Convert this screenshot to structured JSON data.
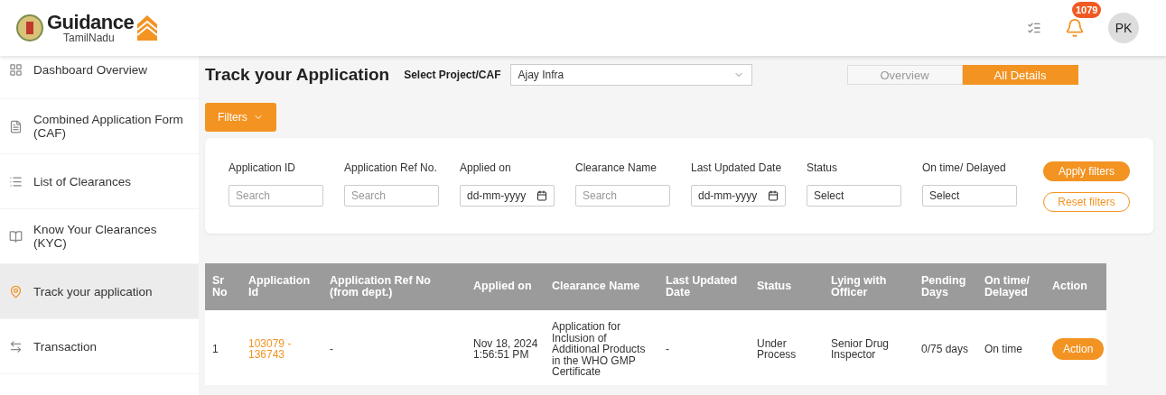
{
  "header": {
    "logo": {
      "title": "Guidance",
      "subtitle": "TamilNadu"
    },
    "notifications": {
      "count": "1079"
    },
    "user": {
      "initials": "PK"
    }
  },
  "sidebar": {
    "items": [
      {
        "label": "Dashboard Overview",
        "selected": false
      },
      {
        "label": "Combined Application Form (CAF)",
        "selected": false
      },
      {
        "label": "List of Clearances",
        "selected": false
      },
      {
        "label": "Know Your Clearances (KYC)",
        "selected": false
      },
      {
        "label": "Track your application",
        "selected": true
      },
      {
        "label": "Transaction",
        "selected": false
      }
    ]
  },
  "page": {
    "title": "Track your Application",
    "project_select": {
      "label": "Select Project/CAF",
      "value": "Ajay Infra"
    },
    "view_tabs": [
      {
        "label": "Overview",
        "selected": false
      },
      {
        "label": "All Details",
        "selected": true
      }
    ],
    "filters_button": "Filters"
  },
  "filters": {
    "fields": [
      {
        "label": "Application ID",
        "kind": "text",
        "placeholder": "Search"
      },
      {
        "label": "Application Ref No.",
        "kind": "text",
        "placeholder": "Search"
      },
      {
        "label": "Applied on",
        "kind": "date",
        "value": "dd-mm-yyyy"
      },
      {
        "label": "Clearance Name",
        "kind": "text",
        "placeholder": "Search"
      },
      {
        "label": "Last Updated Date",
        "kind": "date",
        "value": "dd-mm-yyyy"
      },
      {
        "label": "Status",
        "kind": "select",
        "value": "Select"
      },
      {
        "label": "On time/ Delayed",
        "kind": "select",
        "value": "Select"
      }
    ],
    "apply": "Apply filters",
    "reset": "Reset filters"
  },
  "table": {
    "columns": [
      {
        "label": "Sr No",
        "kind": "text"
      },
      {
        "label": "Application Id",
        "kind": "link"
      },
      {
        "label": "Application Ref No (from dept.)",
        "kind": "text"
      },
      {
        "label": "Applied on",
        "kind": "text"
      },
      {
        "label": "Clearance Name",
        "kind": "text"
      },
      {
        "label": "Last Updated Date",
        "kind": "text"
      },
      {
        "label": "Status",
        "kind": "text"
      },
      {
        "label": "Lying with Officer",
        "kind": "text"
      },
      {
        "label": "Pending Days",
        "kind": "text"
      },
      {
        "label": "On time/ Delayed",
        "kind": "text"
      },
      {
        "label": "Action",
        "kind": "action"
      }
    ],
    "rows": [
      {
        "cells": [
          "1",
          "103079 - 136743",
          "-",
          "Nov 18, 2024 1:56:51 PM",
          "Application for Inclusion of Additional Products in the WHO GMP Certificate",
          "-",
          "Under Process",
          "Senior Drug Inspector",
          "0/75 days",
          "On time",
          "Action"
        ]
      }
    ]
  }
}
